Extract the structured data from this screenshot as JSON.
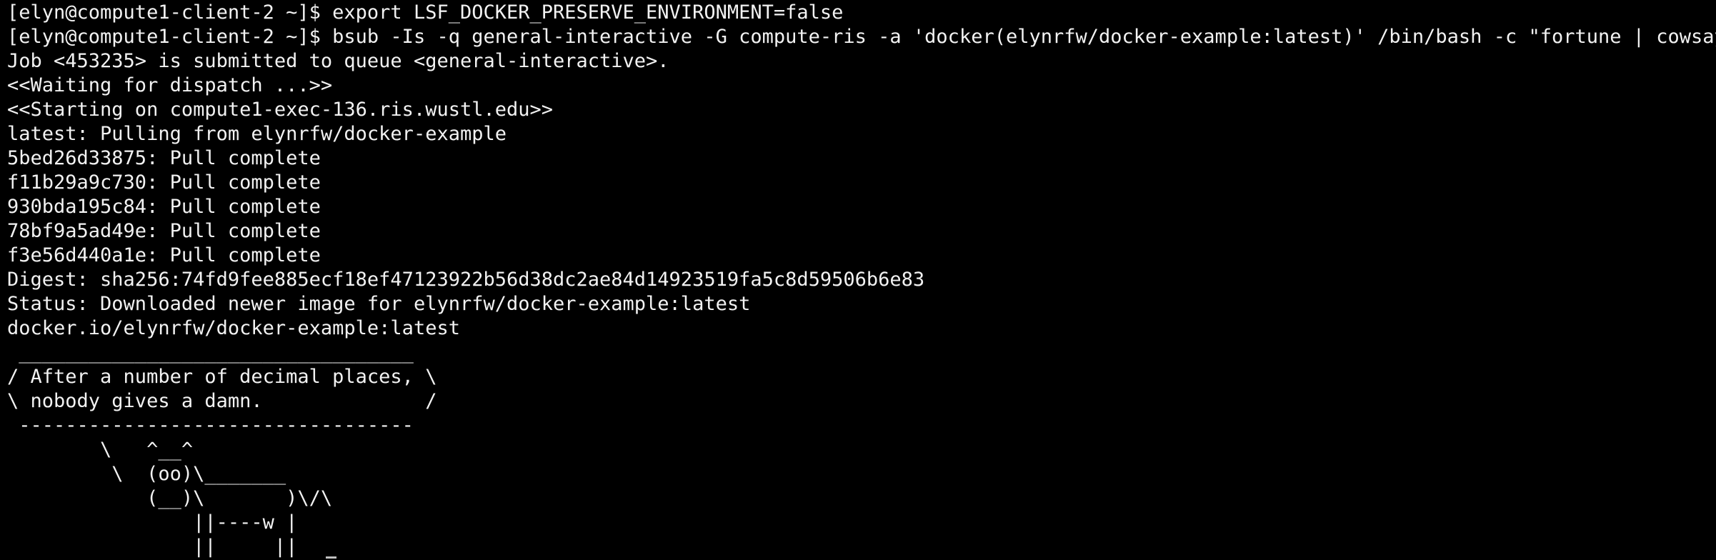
{
  "terminal": {
    "lines": [
      "[elyn@compute1-client-2 ~]$ export LSF_DOCKER_PRESERVE_ENVIRONMENT=false",
      "[elyn@compute1-client-2 ~]$ bsub -Is -q general-interactive -G compute-ris -a 'docker(elynrfw/docker-example:latest)' /bin/bash -c \"fortune | cowsay\"",
      "Job <453235> is submitted to queue <general-interactive>.",
      "<<Waiting for dispatch ...>>",
      "<<Starting on compute1-exec-136.ris.wustl.edu>>",
      "latest: Pulling from elynrfw/docker-example",
      "5bed26d33875: Pull complete",
      "f11b29a9c730: Pull complete",
      "930bda195c84: Pull complete",
      "78bf9a5ad49e: Pull complete",
      "f3e56d440a1e: Pull complete",
      "Digest: sha256:74fd9fee885ecf18ef47123922b56d38dc2ae84d14923519fa5c8d59506b6e83",
      "Status: Downloaded newer image for elynrfw/docker-example:latest",
      "docker.io/elynrfw/docker-example:latest",
      " __________________________________",
      "/ After a number of decimal places, \\",
      "\\ nobody gives a damn.              /",
      " ----------------------------------",
      "        \\   ^__^",
      "         \\  (oo)\\_______",
      "            (__)\\       )\\/\\",
      "                ||----w |",
      "                ||     ||"
    ]
  }
}
